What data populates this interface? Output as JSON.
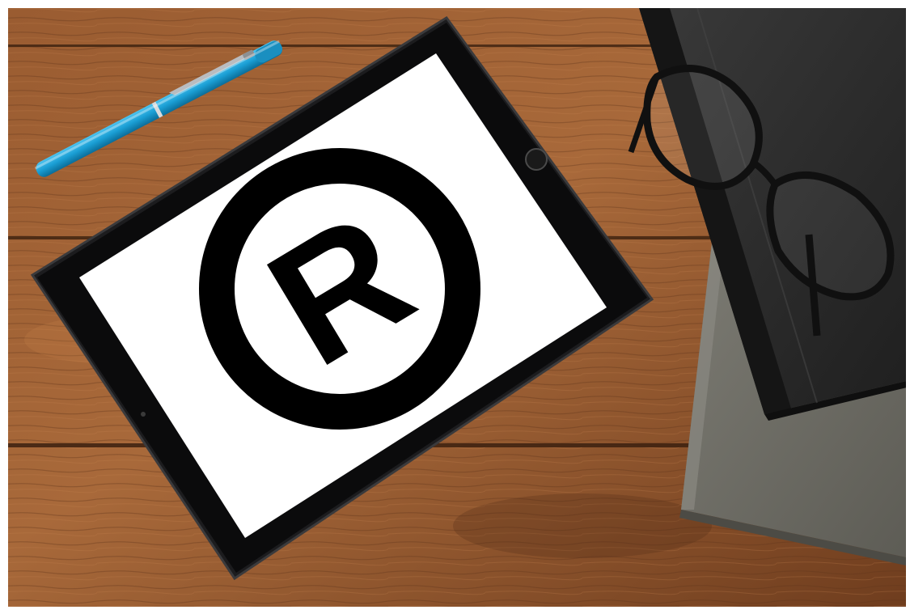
{
  "scene": {
    "subject": "tablet-with-registered-trademark",
    "logo_glyph": "R",
    "logo_symbol": "®",
    "colors": {
      "frame": "#ffffff",
      "wood_light": "#a8693a",
      "wood_mid": "#8a5230",
      "wood_dark": "#5e341a",
      "plank_seam": "#3b200f",
      "tablet_body": "#1c1c1e",
      "tablet_bezel": "#0b0b0c",
      "screen": "#ffffff",
      "logo_ink": "#000000",
      "pen_blue": "#1a9ed4",
      "pen_blue_dark": "#0b6d99",
      "pen_clip": "#b9bcc0",
      "book_top": "#2b2b2b",
      "book_bottom": "#6e6d66",
      "glasses_frame": "#101010"
    },
    "icons": [
      "pen-icon",
      "tablet-icon",
      "registered-trademark-icon",
      "home-button-icon",
      "glasses-icon",
      "book-icon"
    ]
  }
}
